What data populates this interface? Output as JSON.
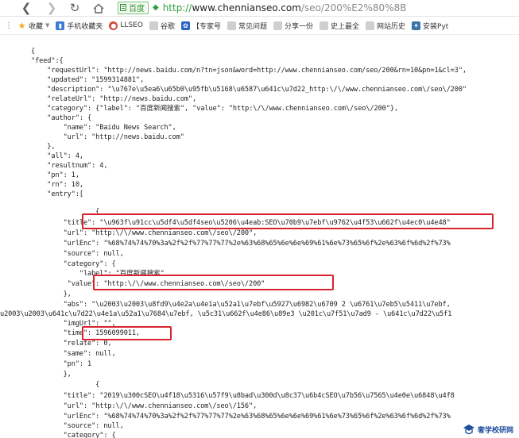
{
  "toolbar": {
    "back_icon": "arrow-left-icon",
    "forward_icon": "arrow-right-icon",
    "reload_icon": "reload-icon",
    "home_icon": "home-icon",
    "site_name": "百度",
    "url_scheme": "http://",
    "url_host": "www.chennianseo.com",
    "url_path": "/seo/200%E2%80%8B"
  },
  "bookmarks": [
    {
      "icon": "star-icon",
      "label": "收藏",
      "color": "#f4a81d"
    },
    {
      "icon": "mobile-icon",
      "label": "手机收藏夹",
      "color": "#3a7bd5"
    },
    {
      "icon": "chrome-icon",
      "label": "LLSEO",
      "color": "#d24a3a"
    },
    {
      "icon": "page-icon",
      "label": "谷歌",
      "color": "#9a9a9a"
    },
    {
      "icon": "paw-icon",
      "label": "【专家号",
      "color": "#2a64c7"
    },
    {
      "icon": "page-icon",
      "label": "常见问题",
      "color": "#9a9a9a"
    },
    {
      "icon": "page-icon",
      "label": "分享一份",
      "color": "#9a9a9a"
    },
    {
      "icon": "page-icon",
      "label": "史上最全",
      "color": "#9a9a9a"
    },
    {
      "icon": "page-icon",
      "label": "网站历史",
      "color": "#9a9a9a"
    },
    {
      "icon": "python-icon",
      "label": "安装Pyt",
      "color": "#3776ab"
    }
  ],
  "json_lines": [
    "{",
    "\"feed\":{",
    "    \"requestUrl\": \"http://news.baidu.com/n?tn=json&word=http://www.chennianseo.com/seo/200&rn=10&pn=1&cl=3\",",
    "    \"updated\": \"1599314881\",",
    "    \"description\": \"\\u767e\\u5ea6\\u65b0\\u95fb\\u5168\\u6587\\u641c\\u7d22_http:\\/\\/www.chennianseo.com\\/seo\\/200\"",
    "    \"relateUrl\": \"http://news.baidu.com\",",
    "    \"category\": {\"label\": \"百度新闻搜索\", \"value\": \"http:\\/\\/www.chennianseo.com\\/seo\\/200\"},",
    "    \"author\": {",
    "        \"name\": \"Baidu News Search\",",
    "        \"url\": \"http://news.baidu.com\"",
    "    },",
    "    \"all\": 4,",
    "    \"resultnum\": 4,",
    "    \"pn\": 1,",
    "    \"rn\": 10,",
    "    \"entry\":[",
    "                {",
    "        \"title\": \"\\u963f\\u91cc\\u5df4\\u5df4seo\\u5206\\u4eab:SEO\\u70b9\\u7ebf\\u9762\\u4f53\\u662f\\u4ec0\\u4e48\"",
    "        \"url\": \"http:\\/\\/www.chennianseo.com\\/seo\\/200\",",
    "        \"urlEnc\": \"%68%74%74%70%3a%2f%2f%77%77%77%2e%63%68%65%6e%6e%69%61%6e%73%65%6f%2e%63%6f%6d%2f%73%",
    "        \"source\": null,",
    "        \"category\": {",
    "            \"label\": \"百度新闻搜索\"",
    "         \"value\": \"http:\\/\\/www.chennianseo.com\\/seo\\/200\"",
    "        },",
    "        \"abs\": \"\\u2003\\u2003\\u8fd9\\u4e2a\\u4e1a\\u52a1\\u7ebf\\u5927\\u6982\\u6709 2 \\u6761\\u7eb5\\u5411\\u7ebf,",
    "u2003\\u2003\\u641c\\u7d22\\u4e1a\\u52a1\\u7684\\u7ebf, \\u5c31\\u662f\\u4e86\\u89e3 \\u201c\\u7f51\\u7ad9 - \\u641c\\u7d22\\u5f1",
    "        \"imgUrl\": \"\",",
    "        \"time\": 1596099011,",
    "        \"relate\": 0,",
    "        \"same\": null,",
    "        \"pn\": 1",
    "        },",
    "                {",
    "        \"title\": \"2019\\u300cSEO\\u4f18\\u5316\\u57f9\\u8bad\\u300d\\u8c37\\u6b4cSEO\\u7b56\\u7565\\u4e0e\\u6848\\u4f8",
    "        \"url\": \"http:\\/\\/www.chennianseo.com\\/seo\\/156\",",
    "        \"urlEnc\": \"%68%74%74%70%3a%2f%2f%77%77%77%2e%63%68%65%6e%6e%69%61%6e%73%65%6f%2e%63%6f%6d%2f%73%",
    "        \"source\": null,",
    "        \"category\": {"
  ],
  "watermark": {
    "text": "奢学校研网",
    "icon": "school-logo-icon"
  }
}
